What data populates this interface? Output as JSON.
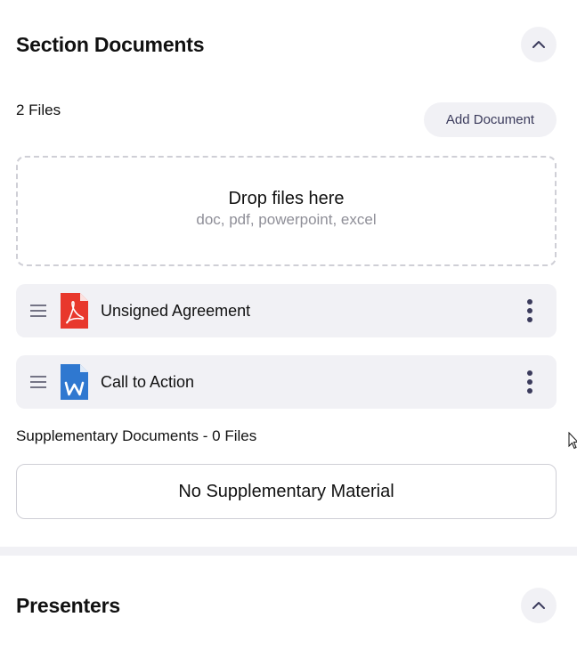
{
  "section_documents": {
    "title": "Section Documents",
    "files_count": "2 Files",
    "add_document_label": "Add Document",
    "dropzone": {
      "title": "Drop files here",
      "subtitle": "doc, pdf, powerpoint, excel"
    },
    "files": [
      {
        "name": "Unsigned Agreement",
        "type": "pdf-file-icon"
      },
      {
        "name": "Call to Action",
        "type": "word-file-icon"
      }
    ]
  },
  "supplementary": {
    "title": "Supplementary Documents - 0 Files",
    "empty_label": "No Supplementary Material"
  },
  "presenters": {
    "title": "Presenters"
  },
  "colors": {
    "pill_bg": "#f1f1f5",
    "accent": "#3b3b5c",
    "pdf_red": "#e8382c",
    "word_blue": "#2f78d0"
  }
}
